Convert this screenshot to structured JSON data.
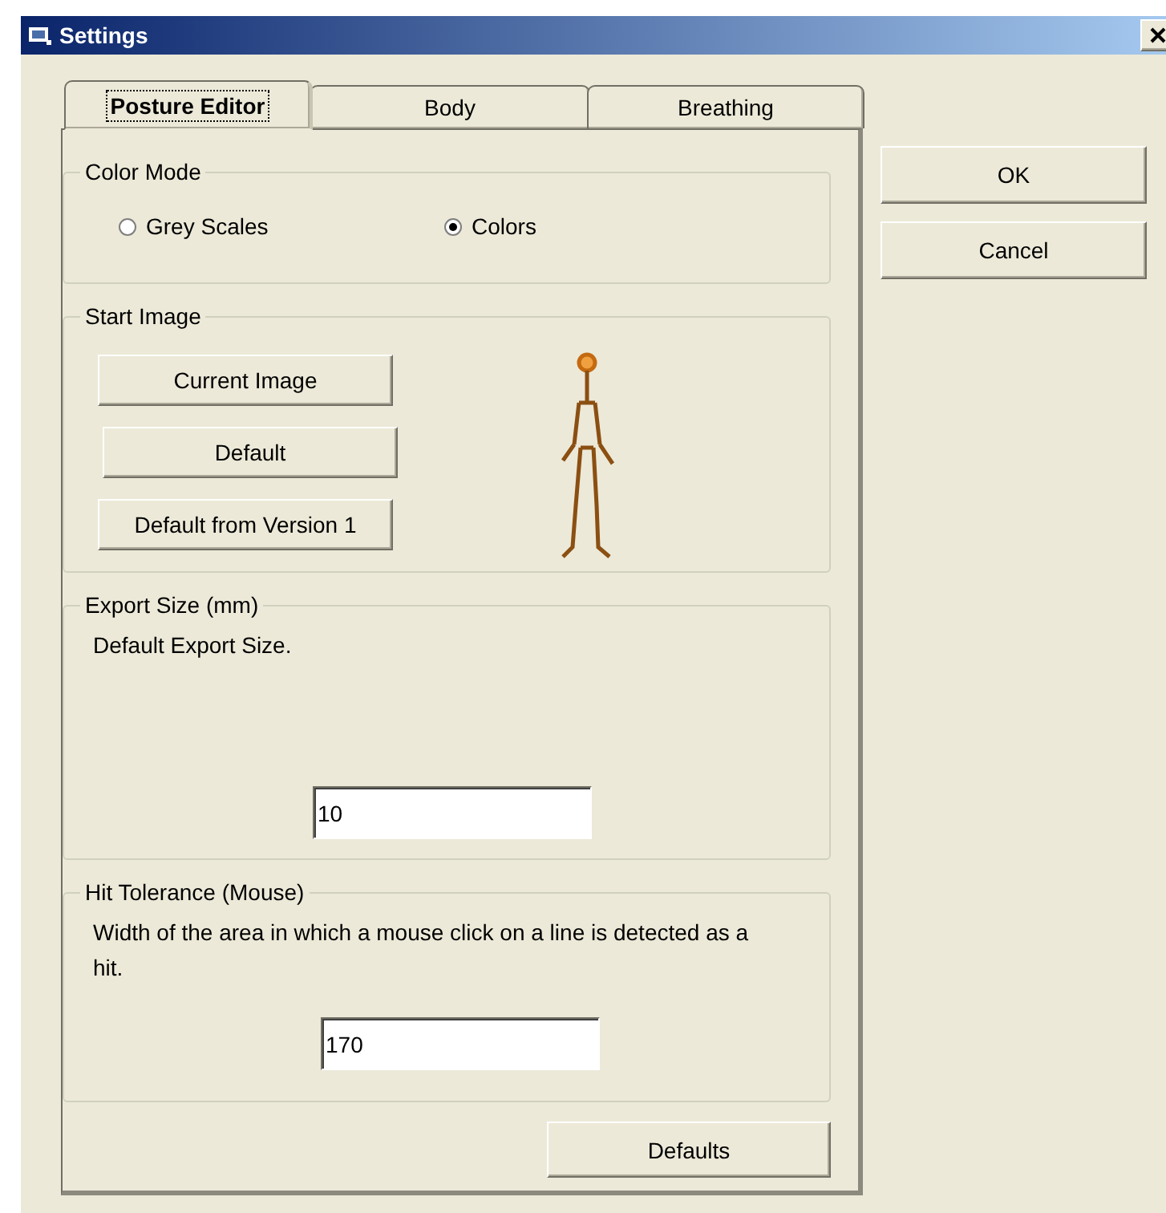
{
  "window": {
    "title": "Settings"
  },
  "tabs": [
    {
      "label": "Posture Editor",
      "selected": true
    },
    {
      "label": "Body",
      "selected": false
    },
    {
      "label": "Breathing",
      "selected": false
    }
  ],
  "color_mode": {
    "title": "Color Mode",
    "options": [
      {
        "label": "Grey Scales",
        "selected": false
      },
      {
        "label": "Colors",
        "selected": true
      }
    ]
  },
  "start_image": {
    "title": "Start Image",
    "buttons": [
      "Current Image",
      "Default",
      "Default from Version 1"
    ]
  },
  "export_size": {
    "title": "Export Size (mm)",
    "description": "Default Export Size.",
    "value": "10"
  },
  "hit_tolerance": {
    "title": "Hit Tolerance (Mouse)",
    "description": "Width of the area in which a mouse click on a line is detected as a hit.",
    "value": "170"
  },
  "defaults_button": "Defaults",
  "side_buttons": [
    "OK",
    "Cancel"
  ]
}
